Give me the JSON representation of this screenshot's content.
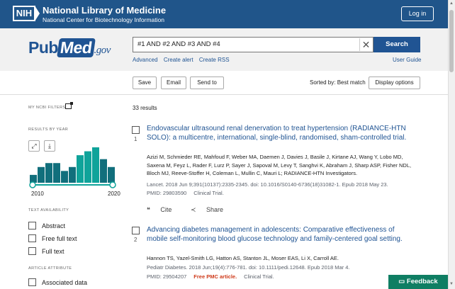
{
  "nih": {
    "logo_text": "NIH",
    "title": "National Library of Medicine",
    "subtitle": "National Center for Biotechnology Information",
    "login_label": "Log in"
  },
  "header": {
    "logo_pub": "Pub",
    "logo_med": "Med",
    "logo_gov": ".gov",
    "search_value": "#1 AND #2 AND #3 AND #4",
    "search_label": "Search",
    "links": [
      "Advanced",
      "Create alert",
      "Create RSS"
    ],
    "user_guide": "User Guide"
  },
  "toolbar": {
    "save": "Save",
    "email": "Email",
    "send_to": "Send to",
    "sorted_by": "Sorted by: Best match",
    "display_options": "Display options"
  },
  "sidebar": {
    "my_filters": "MY NCBI FILTERS",
    "results_by_year": "RESULTS BY YEAR",
    "expand_icon": "expand-icon",
    "download_icon": "download-icon",
    "year_start": "2010",
    "year_end": "2020",
    "text_availability": "TEXT AVAILABILITY",
    "text_filters": [
      "Abstract",
      "Free full text",
      "Full text"
    ],
    "article_attribute": "ARTICLE ATTRIBUTE",
    "attribute_filters": [
      "Associated data"
    ]
  },
  "chart_data": {
    "type": "bar",
    "categories": [
      "2010",
      "2011",
      "2012",
      "2013",
      "2014",
      "2015",
      "2016",
      "2017",
      "2018",
      "2019",
      "2020"
    ],
    "values": [
      2,
      4,
      5,
      5,
      3,
      4,
      7,
      8,
      9,
      6,
      4
    ],
    "xlabel": "",
    "ylabel": "",
    "highlight_color": "#0fa39a",
    "base_color": "#116f7c"
  },
  "results": {
    "count": "33 results",
    "items": [
      {
        "num": "1",
        "title": "Endovascular ultrasound renal denervation to treat hypertension (RADIANCE-HTN SOLO): a multicentre, international, single-blind, randomised, sham-controlled trial.",
        "authors": "Azizi M, Schmieder RE, Mahfoud F, Weber MA, Daemen J, Davies J, Basile J, Kirtane AJ, Wang Y, Lobo MD, Saxena M, Feyz L, Rader F, Lurz P, Sayer J, Sapoval M, Levy T, Sanghvi K, Abraham J, Sharp ASP, Fisher NDL, Bloch MJ, Reeve-Stoffer H, Coleman L, Mullin C, Mauri L; RADIANCE-HTN Investigators.",
        "citation": "Lancet. 2018 Jun 9;391(10137):2335-2345. doi: 10.1016/S0140-6736(18)31082-1. Epub 2018 May 23.",
        "pmid": "PMID: 29803590",
        "free": "",
        "type": "Clinical Trial."
      },
      {
        "num": "2",
        "title": "Advancing diabetes management in adolescents: Comparative effectiveness of mobile self-monitoring blood glucose technology and family-centered goal setting.",
        "authors": "Hannon TS, Yazel-Smith LG, Hatton AS, Stanton JL, Moser EAS, Li X, Carroll AE.",
        "citation": "Pediatr Diabetes. 2018 Jun;19(4):776-781. doi: 10.1111/pedi.12648. Epub 2018 Mar 4.",
        "pmid": "PMID: 29504207",
        "free": "Free PMC article.",
        "type": "Clinical Trial."
      }
    ],
    "cite_label": "Cite",
    "share_label": "Share"
  },
  "feedback_label": "Feedback"
}
